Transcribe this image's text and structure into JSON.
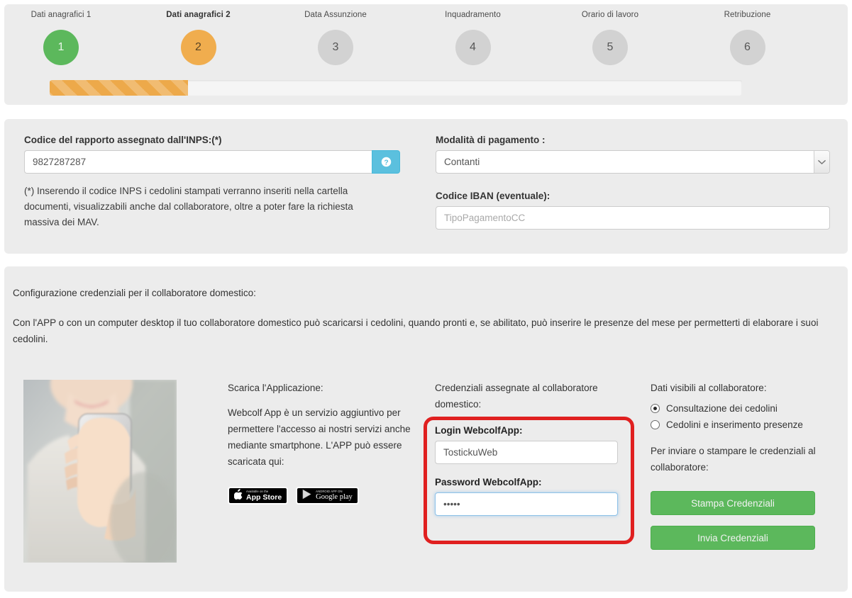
{
  "wizard": {
    "steps": [
      {
        "num": "1",
        "label": "Dati anagrafici 1",
        "state": "done"
      },
      {
        "num": "2",
        "label": "Dati anagrafici 2",
        "state": "current"
      },
      {
        "num": "3",
        "label": "Data Assunzione",
        "state": "todo"
      },
      {
        "num": "4",
        "label": "Inquadramento",
        "state": "todo"
      },
      {
        "num": "5",
        "label": "Orario di lavoro",
        "state": "todo"
      },
      {
        "num": "6",
        "label": "Retribuzione",
        "state": "todo"
      }
    ],
    "progress_percent": 20
  },
  "form": {
    "inps_label": "Codice del rapporto assegnato dall'INPS:(*)",
    "inps_value": "9827287287",
    "inps_placeholder": "",
    "help_icon": "question-mark-icon",
    "hint": "(*) Inserendo il codice INPS i cedolini stampati verranno inseriti nella cartella documenti, visualizzabili anche dal collaboratore, oltre a poter fare la richiesta massiva dei MAV.",
    "payment_label": "Modalità di pagamento :",
    "payment_value": "Contanti",
    "payment_options": [
      "Contanti"
    ],
    "iban_label": "Codice IBAN (eventuale):",
    "iban_value": "",
    "iban_placeholder": "TipoPagamentoCC"
  },
  "credentials": {
    "intro_title": "Configurazione credenziali per il collaboratore domestico:",
    "intro_body": "Con l'APP o con un computer desktop il tuo collaboratore domestico può scaricarsi i cedolini, quando pronti e, se abilitato, può inserire le presenze del mese per permetterti di elaborare i suoi cedolini.",
    "app": {
      "heading": "Scarica l'Applicazione:",
      "body": "Webcolf App è un servizio aggiuntivo per permettere l'accesso ai nostri servizi anche mediante smartphone. L'APP può essere scaricata qui:",
      "appstore_small": "Available on the",
      "appstore_big": "App Store",
      "googleplay_small": "ANDROID APP ON",
      "googleplay_big": "Google play"
    },
    "assigned": {
      "heading": "Credenziali assegnate al collaboratore domestico:",
      "login_label": "Login WebcolfApp:",
      "login_value": "TostickuWeb",
      "password_label": "Password WebcolfApp:",
      "password_value": "•••••"
    },
    "visibility": {
      "heading": "Dati visibili al collaboratore:",
      "options": [
        {
          "label": "Consultazione dei cedolini",
          "selected": true
        },
        {
          "label": "Cedolini e inserimento presenze",
          "selected": false
        }
      ],
      "send_heading": "Per inviare o stampare le credenziali al collaboratore:",
      "print_button": "Stampa Credenziali",
      "send_button": "Invia Credenziali"
    }
  },
  "colors": {
    "done": "#5cb85c",
    "current": "#f0ad4e",
    "todo": "#d2d2d2",
    "panel": "#ececec",
    "help": "#5bc0de",
    "highlight": "#e02020",
    "button_green": "#5cb85c"
  }
}
